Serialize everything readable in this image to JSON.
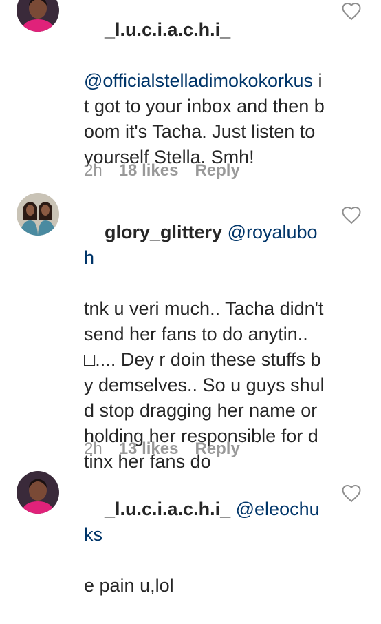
{
  "comments": [
    {
      "username": "_l.u.c.i.a.c.h.i_",
      "mention": "@officialstelladimokokorkus",
      "text": " it got to your inbox and then boom it's Tacha. Just listen to yourself Stella. Smh!",
      "time": "2h",
      "likes": "18 likes",
      "reply": "Reply",
      "avatar": "avatar-pink-woman"
    },
    {
      "username": "glory_glittery",
      "mention": "@royaluboh",
      "text": "tnk u veri much.. Tacha didn't send her fans to do anytin.. □.... Dey r doin these stuffs by demselves.. So u guys shuld stop dragging her name or holding her responsible for d tinx her fans do",
      "time": "2h",
      "likes": "13 likes",
      "reply": "Reply",
      "avatar": "avatar-two-women"
    },
    {
      "username": "_l.u.c.i.a.c.h.i_",
      "mention": "@eleochuks",
      "text": "e pain u,lol",
      "avatar": "avatar-pink-woman"
    }
  ],
  "icons": {
    "like": "heart-outline-icon"
  },
  "colors": {
    "mention": "#003569",
    "meta": "#999999",
    "text": "#262626"
  }
}
